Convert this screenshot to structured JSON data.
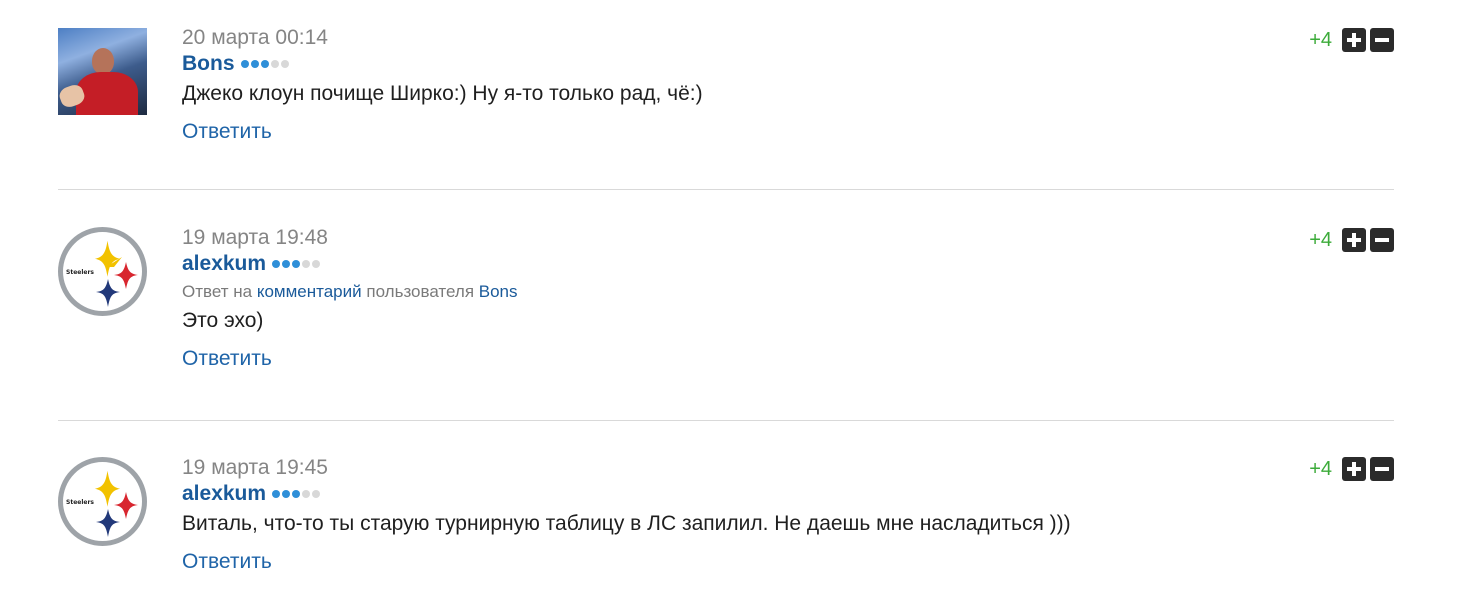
{
  "comments": [
    {
      "date": "20 марта 00:14",
      "author": "Bons",
      "rank_dots": 3,
      "rank_total": 5,
      "text": "Джеко клоун почище Ширко:) Ну я-то только рад, чё:)",
      "reply_label": "Ответить",
      "score": "+4",
      "avatar": "user-photo"
    },
    {
      "date": "19 марта 19:48",
      "author": "alexkum",
      "rank_dots": 3,
      "rank_total": 5,
      "reply_to": {
        "prefix": "Ответ на",
        "link": "комментарий",
        "middle": "пользователя",
        "user": "Bons"
      },
      "text": "Это эхо)",
      "reply_label": "Ответить",
      "score": "+4",
      "avatar": "steelers-logo"
    },
    {
      "date": "19 марта 19:45",
      "author": "alexkum",
      "rank_dots": 3,
      "rank_total": 5,
      "text": "Виталь, что-то ты старую турнирную таблицу в ЛС запилил. Не даешь мне насладиться )))",
      "reply_label": "Ответить",
      "score": "+4",
      "avatar": "steelers-logo"
    }
  ],
  "logo_text": "Steelers",
  "colors": {
    "author": "#1a5a9a",
    "reply_link": "#1f64a8",
    "score_positive": "#3cab3a",
    "vote_button": "#2b2b2b",
    "rank_dot_on": "#2f8fd8",
    "rank_dot_off": "#d8d8d8",
    "divider": "#d9d9d9"
  },
  "icons": {
    "upvote": "plus-icon",
    "downvote": "minus-icon"
  }
}
